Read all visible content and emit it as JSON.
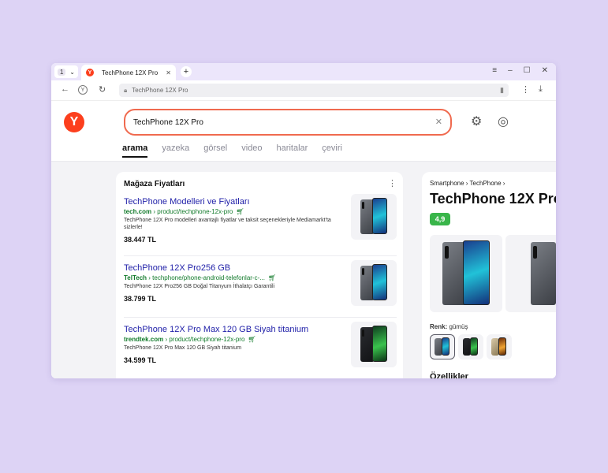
{
  "browser": {
    "tab_count": "1",
    "tab_title": "TechPhone 12X Pro",
    "url": "TechPhone 12X Pro"
  },
  "search": {
    "query": "TechPhone 12X Pro",
    "verticals": [
      "arama",
      "yazeka",
      "görsel",
      "video",
      "haritalar",
      "çeviri"
    ]
  },
  "store_card": {
    "title": "Mağaza Fiyatları",
    "results": [
      {
        "title": "TechPhone Modelleri ve Fiyatları",
        "domain": "tech.com",
        "path": "› product/techphone-12x-pro",
        "desc": "TechPhone 12X Pro modelleri avantajlı fiyatlar ve taksit seçenekleriyle Mediamarkt'ta sizlerle!",
        "price": "38.447 TL"
      },
      {
        "title": "TechPhone 12X Pro256 GB",
        "domain": "TelTech",
        "path": "› techphone/phone-android-telefonlar-c-...",
        "desc": "TechPhone 12X Pro256 GB Doğal Titanyum İthalatçı Garantili",
        "price": "38.799 TL"
      },
      {
        "title": "TechPhone 12X Pro Max 120 GB Siyah titanium",
        "domain": "trendtek.com",
        "path": "› product/techphone-12x-pro",
        "desc": "TechPhone 12X Pro Max 120 GB Siyah titanium",
        "price": "34.599 TL"
      }
    ]
  },
  "product_panel": {
    "breadcrumb": "Smartphone › TechPhone ›",
    "title": "TechPhone 12X Pro",
    "rating": "4,9",
    "color_label": "Renk:",
    "color_value": "gümüş",
    "features_heading": "Özellikler"
  },
  "colors": {
    "brand": "#fc3f1d",
    "link": "#1f1fa8",
    "url": "#117a2a",
    "rating": "#39b54a"
  }
}
